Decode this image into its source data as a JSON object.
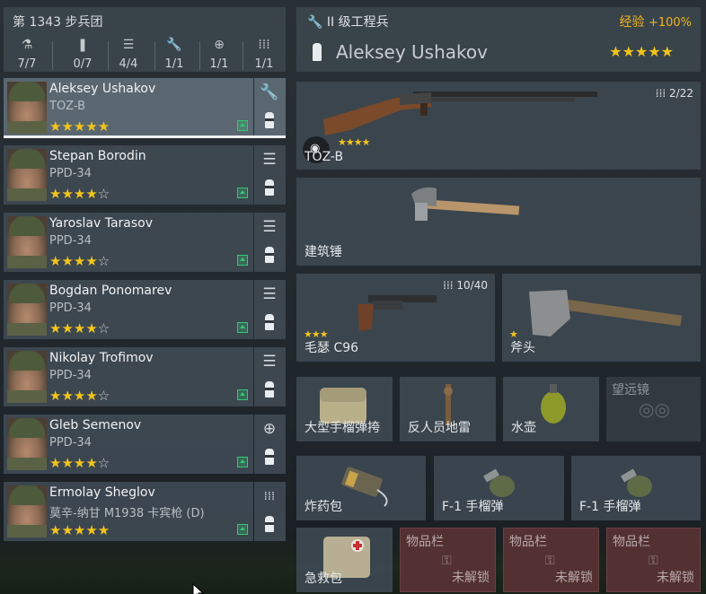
{
  "squad": {
    "title": "第 1343 步兵团",
    "stats": [
      {
        "icon": "person-icon",
        "glyph": "⚇",
        "value": "7/7"
      },
      {
        "icon": "rifle-icon",
        "glyph": "❘",
        "value": "0/7"
      },
      {
        "icon": "list-icon",
        "glyph": "☰",
        "value": "4/4"
      },
      {
        "icon": "wrench-icon",
        "glyph": "🔧",
        "value": "1/1"
      },
      {
        "icon": "medic-icon",
        "glyph": "⊕",
        "value": "1/1"
      },
      {
        "icon": "ammo-icon",
        "glyph": "⁞⁞⁞",
        "value": "1/1"
      }
    ]
  },
  "soldiers": [
    {
      "name": "Aleksey Ushakov",
      "weapon": "TOZ-B",
      "stars": "★★★★★",
      "empty": "",
      "role_glyph": "🔧",
      "role_icon": "wrench-icon"
    },
    {
      "name": "Stepan Borodin",
      "weapon": "PPD-34",
      "stars": "★★★★",
      "empty": "☆",
      "role_glyph": "☰",
      "role_icon": "list-icon"
    },
    {
      "name": "Yaroslav Tarasov",
      "weapon": "PPD-34",
      "stars": "★★★★",
      "empty": "☆",
      "role_glyph": "☰",
      "role_icon": "list-icon"
    },
    {
      "name": "Bogdan Ponomarev",
      "weapon": "PPD-34",
      "stars": "★★★★",
      "empty": "☆",
      "role_glyph": "☰",
      "role_icon": "list-icon"
    },
    {
      "name": "Nikolay Trofimov",
      "weapon": "PPD-34",
      "stars": "★★★★",
      "empty": "☆",
      "role_glyph": "☰",
      "role_icon": "list-icon"
    },
    {
      "name": "Gleb Semenov",
      "weapon": "PPD-34",
      "stars": "★★★★",
      "empty": "☆",
      "role_glyph": "⊕",
      "role_icon": "medic-icon"
    },
    {
      "name": "Ermolay Sheglov",
      "weapon": "莫辛-纳甘 M1938 卡宾枪 (D)",
      "stars": "★★★★★",
      "empty": "",
      "role_glyph": "⁞⁞⁞",
      "role_icon": "ammo-icon"
    }
  ],
  "header": {
    "class_label": "II 级工程兵",
    "exp_label": "经验",
    "exp_value": "+100%",
    "soldier_name": "Aleksey Ushakov",
    "stars": "★★★★★"
  },
  "equipment": {
    "primary": {
      "label": "TOZ-B",
      "stars": "★★★★",
      "ammo": "⁞⁞⁞ 2/22"
    },
    "tool": {
      "label": "建筑锤"
    },
    "secondary": {
      "label": "毛瑟 C96",
      "stars": "★★★",
      "ammo": "⁞⁞⁞ 10/40"
    },
    "melee": {
      "label": "斧头",
      "stars": "★"
    },
    "gear": [
      {
        "label": "大型手榴弹挎"
      },
      {
        "label": "反人员地雷"
      },
      {
        "label": "水壶"
      },
      {
        "label": "望远镜"
      }
    ],
    "grenades": [
      {
        "label": "炸药包"
      },
      {
        "label": "F-1 手榴弹"
      },
      {
        "label": "F-1 手榴弹"
      }
    ],
    "pouch": {
      "label": "急救包"
    },
    "inventory": [
      {
        "title": "物品栏",
        "status": "未解锁"
      },
      {
        "title": "物品栏",
        "status": "未解锁"
      },
      {
        "title": "物品栏",
        "status": "未解锁"
      }
    ]
  },
  "colors": {
    "accent_gold": "#f2c41b",
    "level_green": "#2ecc71",
    "locked_red": "#56323",
    "panel": "#3c4750"
  }
}
